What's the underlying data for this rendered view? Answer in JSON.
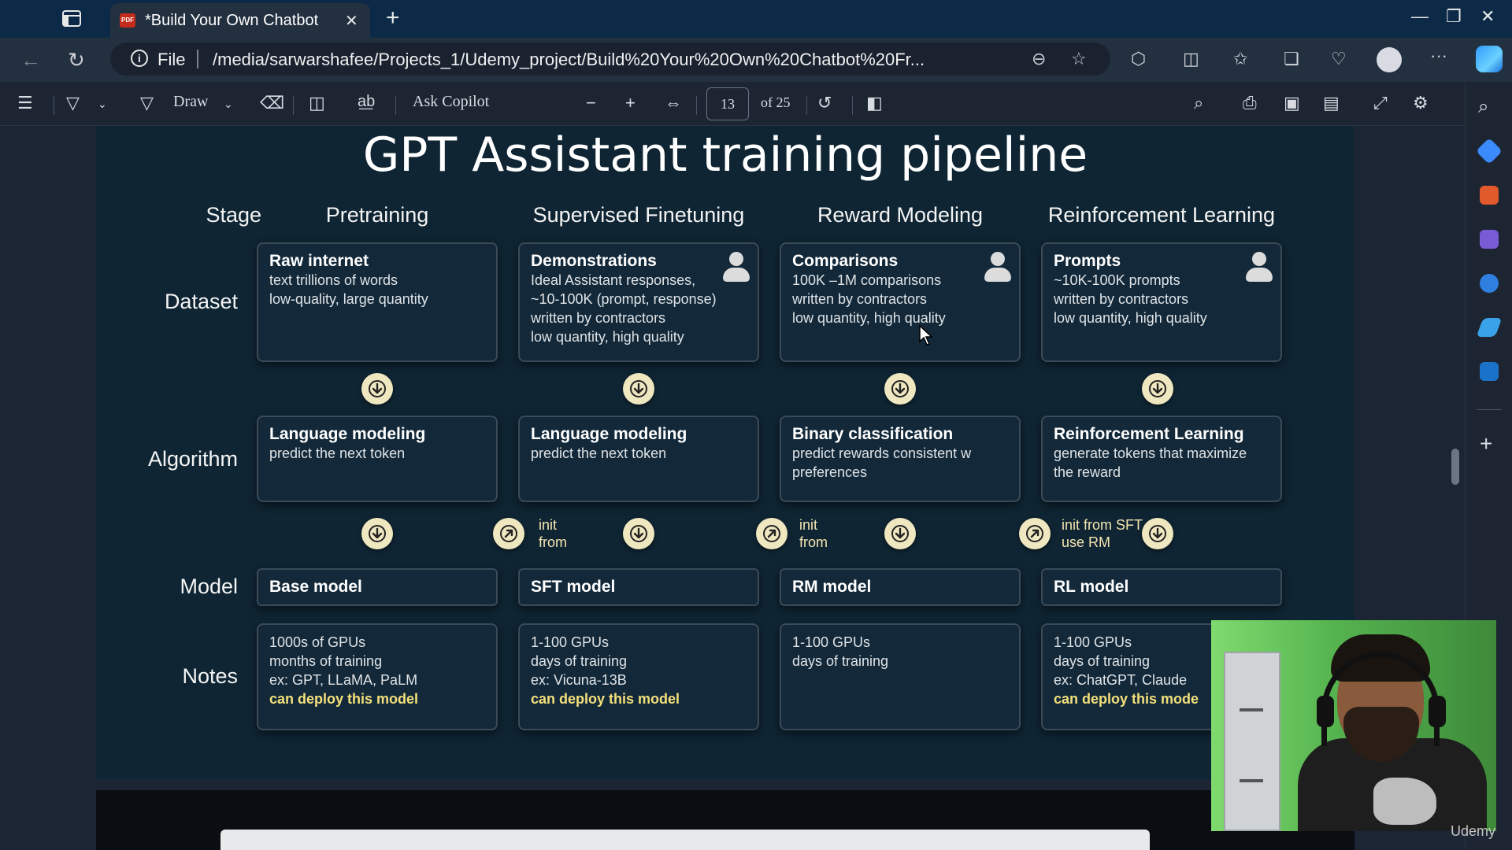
{
  "browser": {
    "tab_title": "*Build Your Own Chatbot",
    "addr_scheme": "File",
    "url": "/media/sarwarshafee/Projects_1/Udemy_project/Build%20Your%20Own%20Chatbot%20Fr..."
  },
  "pdf_toolbar": {
    "draw_label": "Draw",
    "ask_copilot_label": "Ask Copilot",
    "page_number": "13",
    "page_total": "of 25"
  },
  "slide": {
    "title": "GPT Assistant training pipeline",
    "stage_label": "Stage",
    "row_labels": {
      "dataset": "Dataset",
      "algorithm": "Algorithm",
      "model": "Model",
      "notes": "Notes"
    },
    "stages": [
      {
        "name": "Pretraining",
        "dataset": {
          "title": "Raw internet",
          "lines": [
            "text trillions of words",
            "low-quality, large quantity"
          ],
          "person": false
        },
        "algorithm": {
          "title": "Language modeling",
          "lines": [
            "predict the next token"
          ]
        },
        "init": null,
        "model": "Base model",
        "notes": {
          "lines": [
            "1000s of GPUs",
            "months of training",
            "ex: GPT, LLaMA, PaLM"
          ],
          "highlight": "can deploy this model"
        }
      },
      {
        "name": "Supervised Finetuning",
        "dataset": {
          "title": "Demonstrations",
          "lines": [
            "Ideal Assistant responses,",
            "~10-100K (prompt, response)",
            "written by contractors",
            "low quantity, high quality"
          ],
          "person": true
        },
        "algorithm": {
          "title": "Language modeling",
          "lines": [
            "predict the next token"
          ]
        },
        "init": [
          "init",
          "from"
        ],
        "model": "SFT model",
        "notes": {
          "lines": [
            "1-100 GPUs",
            "days of training",
            "ex: Vicuna-13B"
          ],
          "highlight": "can deploy this model"
        }
      },
      {
        "name": "Reward Modeling",
        "dataset": {
          "title": "Comparisons",
          "lines": [
            "100K –1M comparisons",
            "written by contractors",
            "low quantity, high quality"
          ],
          "person": true
        },
        "algorithm": {
          "title": "Binary classification",
          "lines": [
            "predict rewards consistent w",
            "preferences"
          ]
        },
        "init": [
          "init",
          "from"
        ],
        "model": "RM model",
        "notes": {
          "lines": [
            "1-100 GPUs",
            "days of training"
          ],
          "highlight": ""
        }
      },
      {
        "name": "Reinforcement Learning",
        "dataset": {
          "title": "Prompts",
          "lines": [
            "~10K-100K prompts",
            "written by contractors",
            "low quantity, high quality"
          ],
          "person": true
        },
        "algorithm": {
          "title": "Reinforcement Learning",
          "lines": [
            "generate tokens that maximize",
            "the reward"
          ]
        },
        "init": [
          "init from SFT",
          "use RM"
        ],
        "model": "RL model",
        "notes": {
          "lines": [
            "1-100 GPUs",
            "days of training",
            "ex: ChatGPT, Claude"
          ],
          "highlight": "can deploy this mode"
        }
      }
    ]
  },
  "overlay": {
    "watermark": "Udemy"
  },
  "colors": {
    "slide_bg": "#0f2533",
    "card_border": "#3a4a58",
    "highlight_text": "#f4e07a",
    "arrow_circle": "#efe7c0",
    "browser_tabbar": "#0c2a47"
  }
}
